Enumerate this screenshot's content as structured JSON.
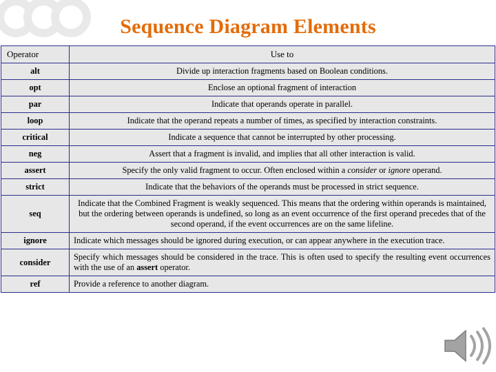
{
  "title": "Sequence Diagram Elements",
  "table": {
    "headers": {
      "operator": "Operator",
      "use_to": "Use to"
    },
    "rows": [
      {
        "operator": "alt",
        "description": "Divide up interaction fragments based on Boolean conditions.",
        "align": "center"
      },
      {
        "operator": "opt",
        "description": "Enclose an optional fragment of interaction",
        "align": "center"
      },
      {
        "operator": "par",
        "description": "Indicate that operands operate in parallel.",
        "align": "center"
      },
      {
        "operator": "loop",
        "description": "Indicate that the operand repeats a number of times, as specified by interaction constraints.",
        "align": "center"
      },
      {
        "operator": "critical",
        "description": "Indicate a sequence that cannot be interrupted by other processing.",
        "align": "center"
      },
      {
        "operator": "neg",
        "description": "Assert that a fragment is invalid, and implies that all other interaction is valid.",
        "align": "center"
      },
      {
        "operator": "assert",
        "description_parts": [
          {
            "text": "Specify the only valid fragment to occur. Often enclosed within a ",
            "style": "normal"
          },
          {
            "text": "consider",
            "style": "italic"
          },
          {
            "text": " or ",
            "style": "normal"
          },
          {
            "text": "ignore",
            "style": "italic"
          },
          {
            "text": " operand.",
            "style": "normal"
          }
        ],
        "align": "center"
      },
      {
        "operator": "strict",
        "description": "Indicate that the behaviors of the operands must be processed in strict sequence.",
        "align": "center"
      },
      {
        "operator": "seq",
        "description": "Indicate that the Combined Fragment is weakly sequenced. This means that the ordering within operands is maintained, but the ordering between operands is undefined, so long as an event occurrence of the first operand precedes that of the second operand, if the event occurrences are on the same lifeline.",
        "align": "center"
      },
      {
        "operator": "ignore",
        "description": "Indicate which messages should be ignored during execution, or can appear anywhere in the execution trace.",
        "align": "justify"
      },
      {
        "operator": "consider",
        "description_parts": [
          {
            "text": "Specify which messages should be considered in the trace. This is often used to specify the resulting event occurrences with the use of an ",
            "style": "normal"
          },
          {
            "text": "assert",
            "style": "bold"
          },
          {
            "text": " operator.",
            "style": "normal"
          }
        ],
        "align": "justify"
      },
      {
        "operator": "ref",
        "description": "Provide a reference to another diagram.",
        "align": "left"
      }
    ]
  },
  "decorations": {
    "title_color": "#E36C0A",
    "table_border_color": "#2B2B8C",
    "row_background": "#E7E7E7",
    "speaker_icon": "speaker-icon",
    "watermark_icon": "circles-watermark"
  }
}
